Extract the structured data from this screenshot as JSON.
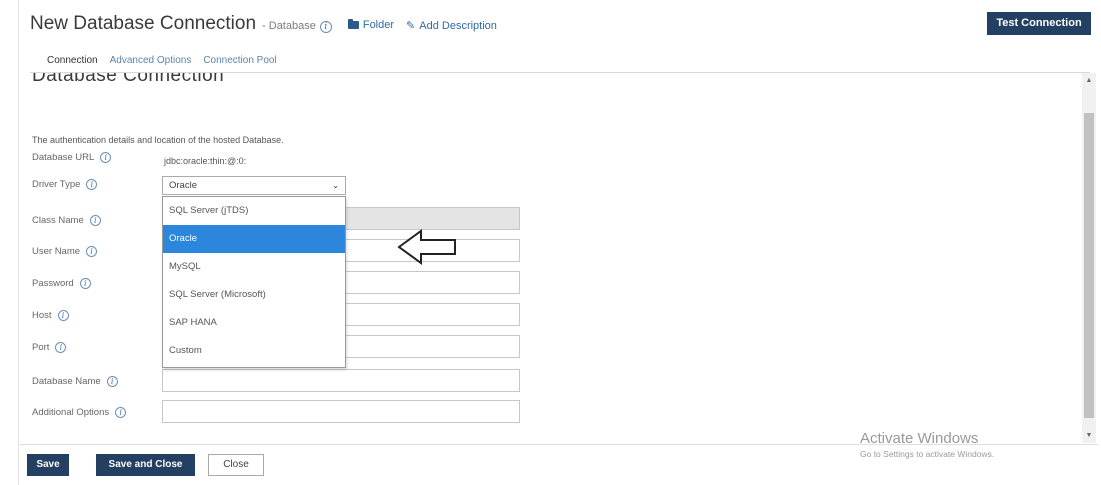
{
  "header": {
    "title": "New Database Connection",
    "subtitle": "- Database",
    "folder_label": "Folder",
    "description_label": "Add Description",
    "test_button": "Test Connection"
  },
  "tabs": [
    {
      "label": "Connection",
      "active": true
    },
    {
      "label": "Advanced Options",
      "active": false
    },
    {
      "label": "Connection Pool",
      "active": false
    }
  ],
  "section": {
    "heading": "Database Connection",
    "description": "The authentication details and location of the hosted Database."
  },
  "form": {
    "database_url": {
      "label": "Database URL",
      "value": "jdbc:oracle:thin:@:0:"
    },
    "driver_type": {
      "label": "Driver Type",
      "value": "Oracle"
    },
    "class_name": {
      "label": "Class Name"
    },
    "user_name": {
      "label": "User Name"
    },
    "password": {
      "label": "Password"
    },
    "host": {
      "label": "Host"
    },
    "port": {
      "label": "Port"
    },
    "database_name": {
      "label": "Database Name"
    },
    "additional_options": {
      "label": "Additional Options"
    }
  },
  "dropdown": {
    "options": [
      "SQL Server (jTDS)",
      "Oracle",
      "MySQL",
      "SQL Server (Microsoft)",
      "SAP HANA",
      "Custom"
    ],
    "selected": "Oracle"
  },
  "footer": {
    "save": "Save",
    "save_close": "Save and Close",
    "close": "Close"
  },
  "watermark": {
    "title": "Activate Windows",
    "subtitle": "Go to Settings to activate Windows."
  },
  "colors": {
    "primary": "#233f62",
    "link": "#2f6aa8",
    "selected": "#2b86dc"
  }
}
